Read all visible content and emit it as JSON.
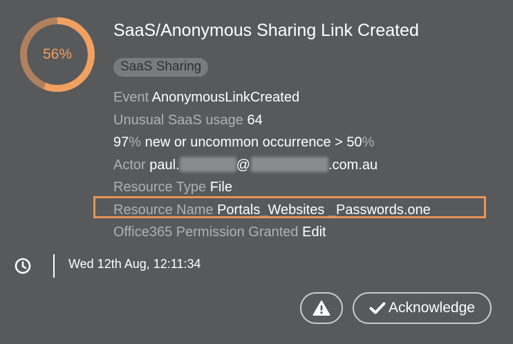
{
  "breach": {
    "score_percent": 56,
    "score_label": "56%",
    "score_color": "#f0a060",
    "ring_track_color": "#b0815f",
    "title": "SaaS/Anonymous Sharing Link Created",
    "tag": "SaaS Sharing"
  },
  "details": {
    "event": {
      "label": "Event",
      "value": "AnonymousLinkCreated"
    },
    "unusual": {
      "label": "Unusual SaaS usage",
      "value": "64"
    },
    "occurrence": {
      "pct1": "97",
      "sign1": "%",
      "mid": " new or uncommon occurrence > ",
      "pct2": "50",
      "sign2": "%"
    },
    "actor": {
      "label": "Actor",
      "prefix": "paul.",
      "at": "@",
      "suffix": ".com.au"
    },
    "resource_type": {
      "label": "Resource Type",
      "value": "File"
    },
    "resource_name": {
      "label": "Resource Name",
      "value": "Portals_Websites _Passwords.one"
    },
    "permission": {
      "label": "Office365 Permission Granted",
      "value": "Edit"
    }
  },
  "highlight_color": "#e8955a",
  "footer": {
    "timestamp": "Wed 12th Aug, 12:11:34",
    "clock_icon": "clock-icon"
  },
  "actions": {
    "alert_icon": "warning-icon",
    "acknowledge_icon": "checkmark-icon",
    "acknowledge_label": "Acknowledge"
  }
}
